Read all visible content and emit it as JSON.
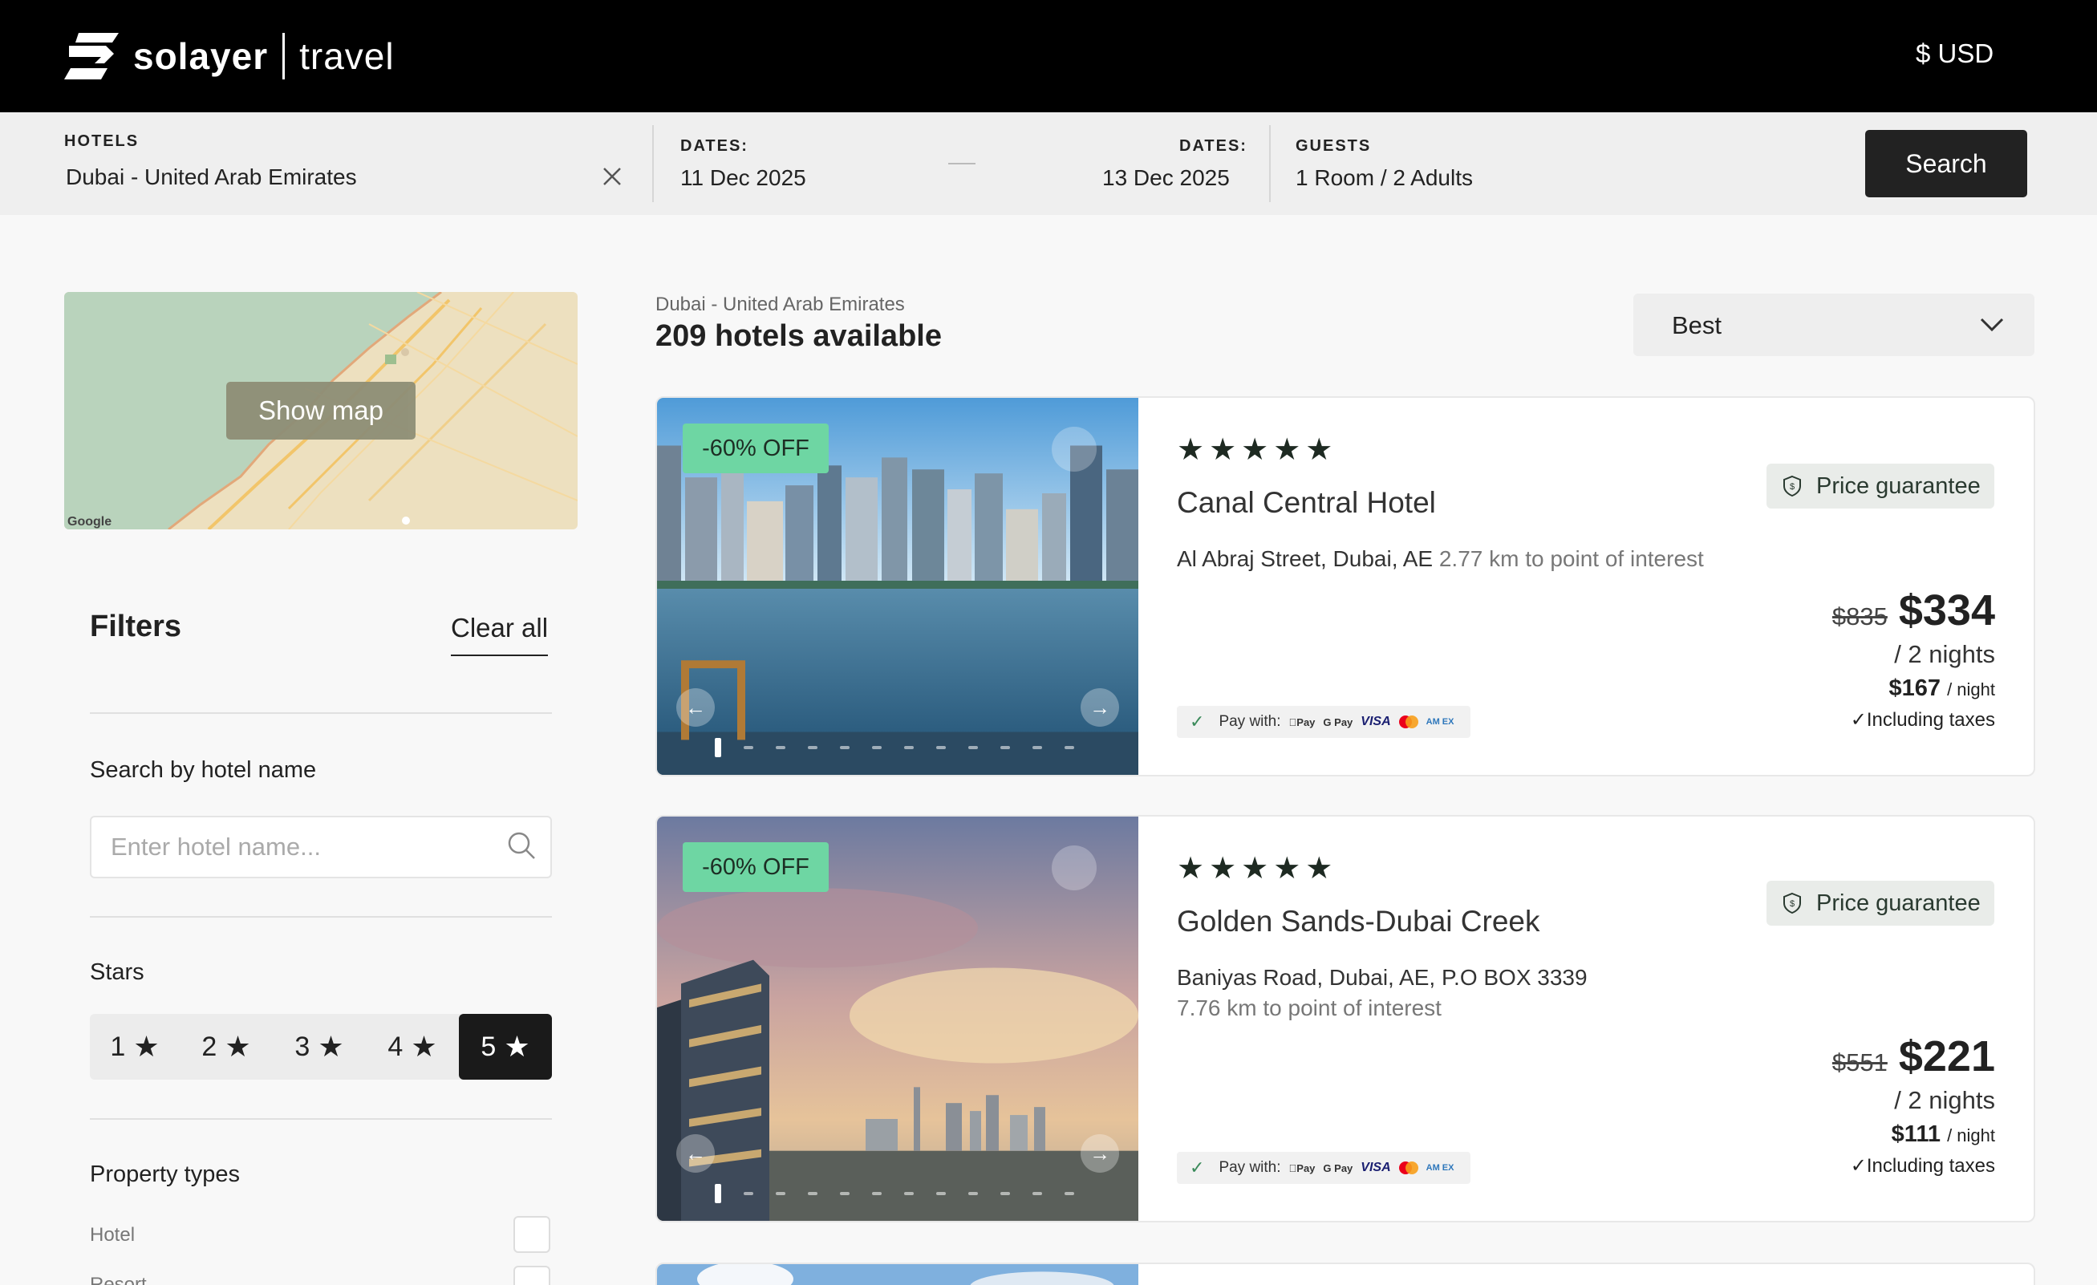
{
  "header": {
    "brand": "solayer",
    "product": "travel",
    "currency": "$ USD"
  },
  "search": {
    "hotels_label": "HOTELS",
    "destination": "Dubai - United Arab Emirates",
    "checkin_label": "DATES:",
    "checkin": "11 Dec 2025",
    "checkout_label": "DATES:",
    "checkout": "13 Dec 2025",
    "guests_label": "GUESTS",
    "guests": "1 Room / 2 Adults",
    "button": "Search"
  },
  "map": {
    "button": "Show map",
    "attribution": "Google"
  },
  "filters": {
    "title": "Filters",
    "clear_all": "Clear all",
    "search_label": "Search by hotel name",
    "search_placeholder": "Enter hotel name...",
    "stars_label": "Stars",
    "stars": [
      {
        "value": "1",
        "selected": false
      },
      {
        "value": "2",
        "selected": false
      },
      {
        "value": "3",
        "selected": false
      },
      {
        "value": "4",
        "selected": false
      },
      {
        "value": "5",
        "selected": true
      }
    ],
    "property_label": "Property types",
    "property_types": [
      "Hotel",
      "Resort"
    ]
  },
  "results": {
    "location": "Dubai - United Arab Emirates",
    "count": "209 hotels available",
    "sort": "Best"
  },
  "hotels": [
    {
      "discount": "-60% OFF",
      "stars": "★★★★★",
      "name": "Canal Central Hotel",
      "address": "Al Abraj Street, Dubai, AE",
      "distance": "2.77 km to point of interest",
      "guarantee": "Price guarantee",
      "pay_with": "Pay with:",
      "old_price": "$835",
      "price": "$334",
      "nights": "/ 2 nights",
      "per_night": "$167",
      "per_night_unit": "/ night",
      "taxes": "✓Including taxes"
    },
    {
      "discount": "-60% OFF",
      "stars": "★★★★★",
      "name": "Golden Sands-Dubai Creek",
      "address": "Baniyas Road, Dubai, AE, P.O BOX 3339",
      "distance": "7.76 km to point of interest",
      "guarantee": "Price guarantee",
      "pay_with": "Pay with:",
      "old_price": "$551",
      "price": "$221",
      "nights": "/ 2 nights",
      "per_night": "$111",
      "per_night_unit": "/ night",
      "taxes": "✓Including taxes"
    }
  ],
  "payment_methods": [
    "Pay",
    "G Pay",
    "VISA",
    "AM EX"
  ],
  "colors": {
    "discount_badge": "#6ed6a3",
    "header_bg": "#000000",
    "search_button": "#222222"
  }
}
